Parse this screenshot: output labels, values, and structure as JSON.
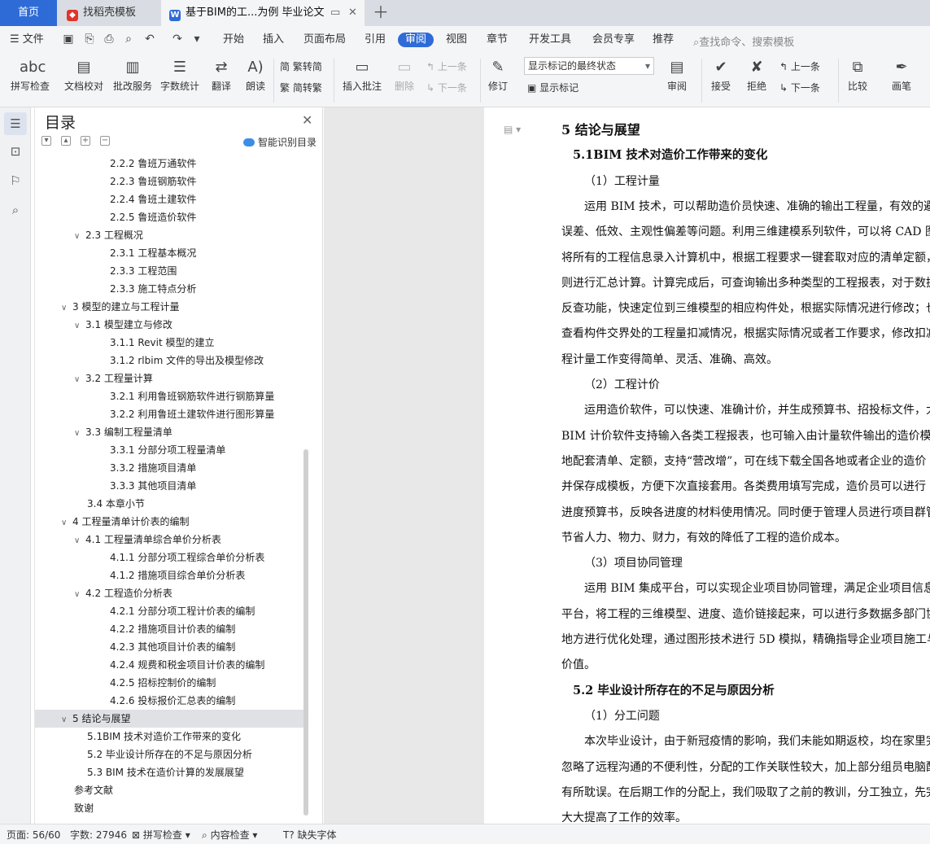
{
  "tabs": {
    "home": "首页",
    "templates": "找稻壳模板",
    "document": "基于BIM的工...为例 毕业论文"
  },
  "menu": {
    "file": "文件",
    "items": [
      "开始",
      "插入",
      "页面布局",
      "引用",
      "审阅",
      "视图",
      "章节",
      "开发工具",
      "会员专享",
      "推荐"
    ],
    "active": "审阅",
    "search_placeholder": "查找命令、搜索模板"
  },
  "ribbon": {
    "spell_check": "拼写检查",
    "doc_proof": "文档校对",
    "batch_service": "批改服务",
    "word_count": "字数统计",
    "translate": "翻译",
    "read_aloud": "朗读",
    "trad_conv": "繁转简",
    "simp_conv": "简转繁",
    "insert_comment": "插入批注",
    "delete": "删除",
    "prev": "上一条",
    "next": "下一条",
    "track": "修订",
    "markup_select": "显示标记的最终状态",
    "show_markup": "显示标记",
    "review": "审阅",
    "accept": "接受",
    "reject": "拒绝",
    "prev2": "上一条",
    "next2": "下一条",
    "compare": "比较",
    "pen": "画笔"
  },
  "toc": {
    "title": "目录",
    "smart": "智能识别目录",
    "items": [
      {
        "label": "2.2.2 鲁班万通软件",
        "level": 3,
        "toggle": ""
      },
      {
        "label": "2.2.3 鲁班钢筋软件",
        "level": 3,
        "toggle": ""
      },
      {
        "label": "2.2.4 鲁班土建软件",
        "level": 3,
        "toggle": ""
      },
      {
        "label": "2.2.5 鲁班造价软件",
        "level": 3,
        "toggle": ""
      },
      {
        "label": "2.3 工程概况",
        "level": 2,
        "toggle": "v"
      },
      {
        "label": "2.3.1 工程基本概况",
        "level": 3,
        "toggle": ""
      },
      {
        "label": "2.3.3 工程范围",
        "level": 3,
        "toggle": ""
      },
      {
        "label": "2.3.3 施工特点分析",
        "level": 3,
        "toggle": ""
      },
      {
        "label": "3 模型的建立与工程计量",
        "level": 1,
        "toggle": "v"
      },
      {
        "label": "3.1 模型建立与修改",
        "level": 2,
        "toggle": "v"
      },
      {
        "label": "3.1.1 Revit  模型的建立",
        "level": 3,
        "toggle": ""
      },
      {
        "label": "3.1.2 rlbim 文件的导出及模型修改",
        "level": 3,
        "toggle": ""
      },
      {
        "label": "3.2 工程量计算",
        "level": 2,
        "toggle": "v"
      },
      {
        "label": "3.2.1 利用鲁班钢筋软件进行钢筋算量",
        "level": 3,
        "toggle": ""
      },
      {
        "label": "3.2.2 利用鲁班土建软件进行图形算量",
        "level": 3,
        "toggle": ""
      },
      {
        "label": "3.3 编制工程量清单",
        "level": 2,
        "toggle": "v"
      },
      {
        "label": "3.3.1 分部分项工程量清单",
        "level": 3,
        "toggle": ""
      },
      {
        "label": "3.3.2 措施项目清单",
        "level": 3,
        "toggle": ""
      },
      {
        "label": "3.3.3 其他项目清单",
        "level": 3,
        "toggle": ""
      },
      {
        "label": "3.4 本章小节",
        "level": 2,
        "toggle": ""
      },
      {
        "label": "4 工程量清单计价表的编制",
        "level": 1,
        "toggle": "v"
      },
      {
        "label": "4.1 工程量清单综合单价分析表",
        "level": 2,
        "toggle": "v"
      },
      {
        "label": "4.1.1 分部分项工程综合单价分析表",
        "level": 3,
        "toggle": ""
      },
      {
        "label": "4.1.2 措施项目综合单价分析表",
        "level": 3,
        "toggle": ""
      },
      {
        "label": "4.2 工程造价分析表",
        "level": 2,
        "toggle": "v"
      },
      {
        "label": "4.2.1 分部分项工程计价表的编制",
        "level": 3,
        "toggle": ""
      },
      {
        "label": "4.2.2 措施项目计价表的编制",
        "level": 3,
        "toggle": ""
      },
      {
        "label": "4.2.3 其他项目计价表的编制",
        "level": 3,
        "toggle": ""
      },
      {
        "label": "4.2.4 规费和税金项目计价表的编制",
        "level": 3,
        "toggle": ""
      },
      {
        "label": "4.2.5 招标控制价的编制",
        "level": 3,
        "toggle": ""
      },
      {
        "label": "4.2.6 投标报价汇总表的编制",
        "level": 3,
        "toggle": ""
      },
      {
        "label": "5 结论与展望",
        "level": 1,
        "toggle": "v",
        "selected": true
      },
      {
        "label": "5.1BIM 技术对造价工作带来的变化",
        "level": 2,
        "toggle": ""
      },
      {
        "label": "5.2 毕业设计所存在的不足与原因分析",
        "level": 2,
        "toggle": ""
      },
      {
        "label": "5.3 BIM 技术在造价计算的发展展望",
        "level": 2,
        "toggle": ""
      },
      {
        "label": "参考文献",
        "level": 1,
        "toggle": ""
      },
      {
        "label": "致谢",
        "level": 1,
        "toggle": ""
      }
    ]
  },
  "document": {
    "lines": [
      {
        "text": "5 结论与展望",
        "style": "h1",
        "indent": 0
      },
      {
        "text": "5.1BIM 技术对造价工作带来的变化",
        "style": "h2",
        "indent": 14
      },
      {
        "text": "（1）工程计量",
        "style": "p",
        "indent": 28
      },
      {
        "text": "运用  BIM  技术，可以帮助造价员快速、准确的输出工程量，有效的避",
        "style": "p",
        "indent": 28
      },
      {
        "text": "误差、低效、主观性偏差等问题。利用三维建模系列软件，可以将  CAD  图",
        "style": "p",
        "indent": 0
      },
      {
        "text": "将所有的工程信息录入计算机中，根据工程要求一键套取对应的清单定额，",
        "style": "p",
        "indent": 0
      },
      {
        "text": "则进行汇总计算。计算完成后，可查询输出多种类型的工程报表，对于数据",
        "style": "p",
        "indent": 0
      },
      {
        "text": "反查功能，快速定位到三维模型的相应构件处，根据实际情况进行修改；也",
        "style": "p",
        "indent": 0
      },
      {
        "text": "查看构件交界处的工程量扣减情况，根据实际情况或者工作要求，修改扣减",
        "style": "p",
        "indent": 0
      },
      {
        "text": "程计量工作变得简单、灵活、准确、高效。",
        "style": "p",
        "indent": 0
      },
      {
        "text": "（2）工程计价",
        "style": "p",
        "indent": 28
      },
      {
        "text": "运用造价软件，可以快速、准确计价，并生成预算书、招投标文件，大",
        "style": "p",
        "indent": 28
      },
      {
        "text": "BIM  计价软件支持输入各类工程报表，也可输入由计量软件输出的造价模型",
        "style": "p",
        "indent": 0
      },
      {
        "text": "地配套清单、定额，支持“营改增”，可在线下载全国各地或者企业的造价",
        "style": "p",
        "indent": 0
      },
      {
        "text": "并保存成模板，方便下次直接套用。各类费用填写完成，造价员可以进行",
        "style": "p",
        "indent": 0
      },
      {
        "text": "进度预算书，反映各进度的材料使用情况。同时便于管理人员进行项目群管",
        "style": "p",
        "indent": 0
      },
      {
        "text": "节省人力、物力、财力，有效的降低了工程的造价成本。",
        "style": "p",
        "indent": 0
      },
      {
        "text": "（3）项目协同管理",
        "style": "p",
        "indent": 28
      },
      {
        "text": "运用  BIM  集成平台，可以实现企业项目协同管理，满足企业项目信息化",
        "style": "p",
        "indent": 28
      },
      {
        "text": "平台，将工程的三维模型、进度、造价链接起来，可以进行多数据多部门协",
        "style": "p",
        "indent": 0
      },
      {
        "text": "地方进行优化处理，通过图形技术进行  5D  模拟，精确指导企业项目施工与",
        "style": "p",
        "indent": 0
      },
      {
        "text": "价值。",
        "style": "p",
        "indent": 0
      },
      {
        "text": "5.2 毕业设计所存在的不足与原因分析",
        "style": "h2",
        "indent": 14
      },
      {
        "text": "（1）分工问题",
        "style": "p",
        "indent": 28
      },
      {
        "text": "本次毕业设计，由于新冠疫情的影响，我们未能如期返校，均在家里完",
        "style": "p",
        "indent": 28
      },
      {
        "text": "忽略了远程沟通的不便利性，分配的工作关联性较大，加上部分组员电脑配",
        "style": "p",
        "indent": 0
      },
      {
        "text": "有所耽误。在后期工作的分配上，我们吸取了之前的教训，分工独立，先完",
        "style": "p",
        "indent": 0
      },
      {
        "text": "大大提高了工作的效率。",
        "style": "p",
        "indent": 0
      }
    ]
  },
  "status": {
    "page": "页面: 56/60",
    "words": "字数: 27946",
    "spell": "拼写检查",
    "content": "内容检查",
    "missing_font": "缺失字体"
  }
}
